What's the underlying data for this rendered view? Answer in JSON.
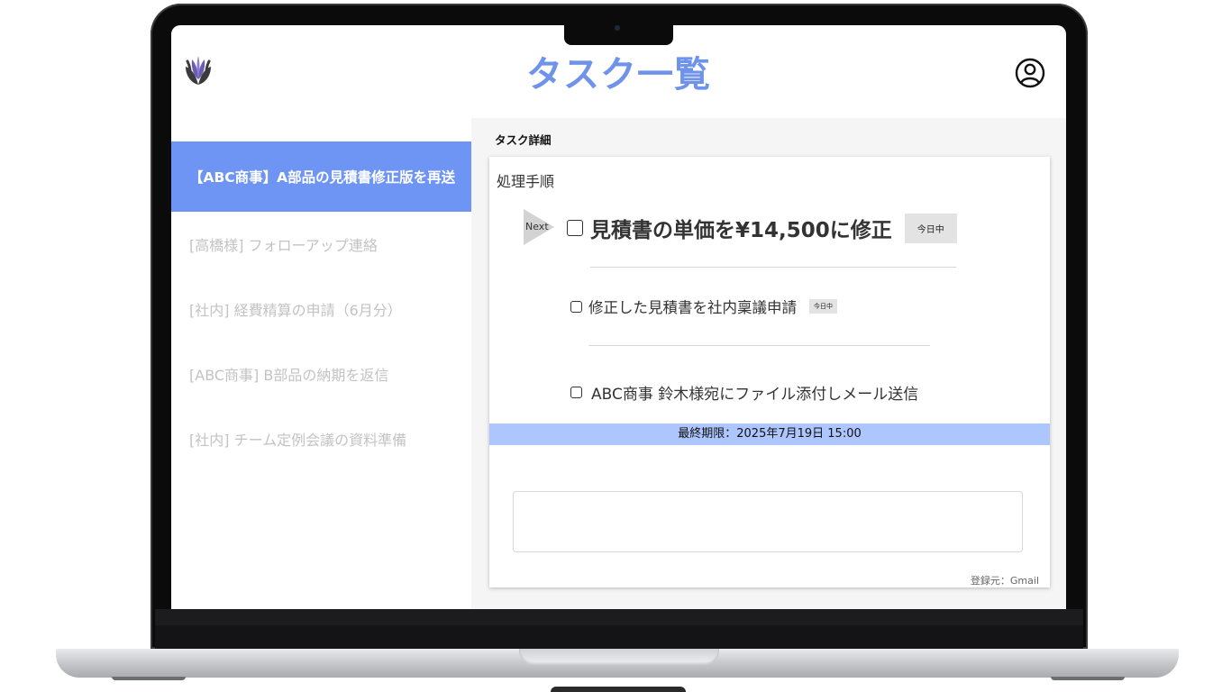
{
  "app": {
    "title": "タスク一覧",
    "logo_icon": "leaf-logo-icon",
    "profile_icon": "user-profile-icon",
    "accent_color": "#6f93ea"
  },
  "sidebar": {
    "items": [
      {
        "label": "【ABC商事】A部品の見積書修正版を再送",
        "active": true
      },
      {
        "label": "[高橋様] フォローアップ連絡",
        "active": false
      },
      {
        "label": "[社内] 経費精算の申請（6月分）",
        "active": false
      },
      {
        "label": "[ABC商事] B部品の納期を返信",
        "active": false
      },
      {
        "label": "[社内] チーム定例会議の資料準備",
        "active": false
      }
    ],
    "active_color": "#6f95f4"
  },
  "detail": {
    "header": "タスク詳細",
    "procedure_label": "処理手順",
    "next_label": "Next",
    "steps": [
      {
        "text": "見積書の単価を¥14,500に修正",
        "badge": "今日中",
        "checked": false
      },
      {
        "text": "修正した見積書を社内稟議申請",
        "badge": "今日中",
        "checked": false
      },
      {
        "text": "ABC商事 鈴木様宛にファイル添付しメール送信",
        "badge": "",
        "checked": false
      }
    ],
    "deadline": "最終期限：2025年7月19日 15:00",
    "deadline_color": "#adc6fd",
    "memo_value": "",
    "source": "登録元：Gmail"
  }
}
